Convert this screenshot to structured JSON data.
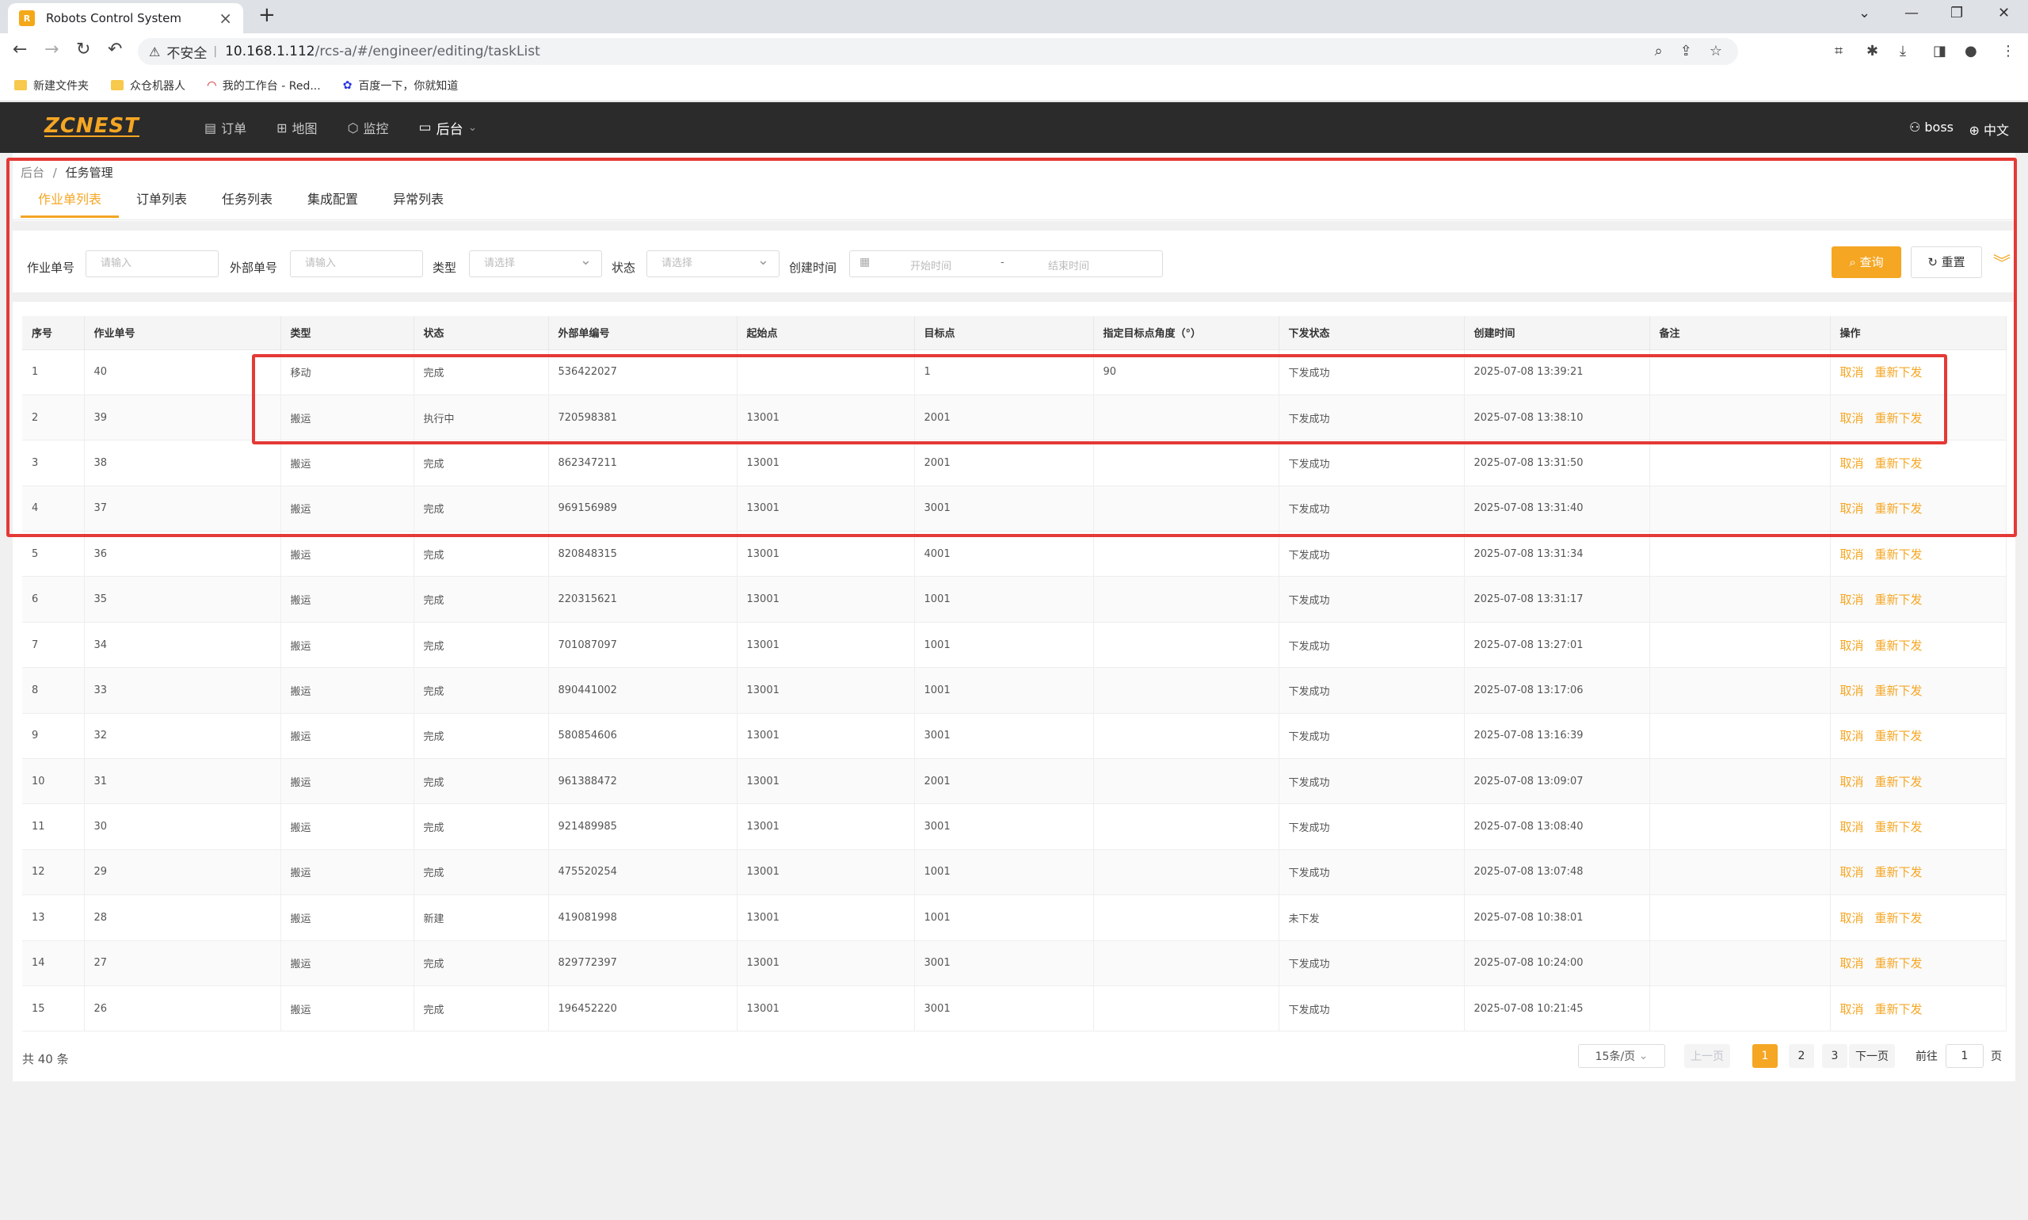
{
  "browser": {
    "tab_title": "Robots Control System",
    "insecure_label": "不安全",
    "url_host": "10.168.1.112",
    "url_path": "/rcs-a/#/engineer/editing/taskList",
    "bookmarks": [
      "新建文件夹",
      "众仓机器人",
      "我的工作台 - Red...",
      "百度一下，你就知道"
    ]
  },
  "app": {
    "logo": "ZCNEST",
    "nav": [
      "订单",
      "地图",
      "监控",
      "后台"
    ],
    "user": "boss",
    "lang": "中文"
  },
  "breadcrumb": {
    "root": "后台",
    "sep": "/",
    "current": "任务管理"
  },
  "tabs": [
    "作业单列表",
    "订单列表",
    "任务列表",
    "集成配置",
    "异常列表"
  ],
  "filter": {
    "labels": [
      "作业单号",
      "外部单号",
      "类型",
      "状态",
      "创建时间"
    ],
    "input_placeholder": "请输入",
    "select_placeholder": "请选择",
    "date_start": "开始时间",
    "date_sep": "-",
    "date_end": "结束时间",
    "query": "查询",
    "reset": "重置"
  },
  "table": {
    "columns": [
      "序号",
      "作业单号",
      "类型",
      "状态",
      "外部单编号",
      "起始点",
      "目标点",
      "指定目标点角度（°）",
      "下发状态",
      "创建时间",
      "备注",
      "操作"
    ],
    "op_cancel": "取消",
    "op_resend": "重新下发",
    "rows": [
      [
        "1",
        "40",
        "移动",
        "完成",
        "536422027",
        "",
        "1",
        "90",
        "下发成功",
        "2025-07-08 13:39:21",
        ""
      ],
      [
        "2",
        "39",
        "搬运",
        "执行中",
        "720598381",
        "13001",
        "2001",
        "",
        "下发成功",
        "2025-07-08 13:38:10",
        ""
      ],
      [
        "3",
        "38",
        "搬运",
        "完成",
        "862347211",
        "13001",
        "2001",
        "",
        "下发成功",
        "2025-07-08 13:31:50",
        ""
      ],
      [
        "4",
        "37",
        "搬运",
        "完成",
        "969156989",
        "13001",
        "3001",
        "",
        "下发成功",
        "2025-07-08 13:31:40",
        ""
      ],
      [
        "5",
        "36",
        "搬运",
        "完成",
        "820848315",
        "13001",
        "4001",
        "",
        "下发成功",
        "2025-07-08 13:31:34",
        ""
      ],
      [
        "6",
        "35",
        "搬运",
        "完成",
        "220315621",
        "13001",
        "1001",
        "",
        "下发成功",
        "2025-07-08 13:31:17",
        ""
      ],
      [
        "7",
        "34",
        "搬运",
        "完成",
        "701087097",
        "13001",
        "1001",
        "",
        "下发成功",
        "2025-07-08 13:27:01",
        ""
      ],
      [
        "8",
        "33",
        "搬运",
        "完成",
        "890441002",
        "13001",
        "1001",
        "",
        "下发成功",
        "2025-07-08 13:17:06",
        ""
      ],
      [
        "9",
        "32",
        "搬运",
        "完成",
        "580854606",
        "13001",
        "3001",
        "",
        "下发成功",
        "2025-07-08 13:16:39",
        ""
      ],
      [
        "10",
        "31",
        "搬运",
        "完成",
        "961388472",
        "13001",
        "2001",
        "",
        "下发成功",
        "2025-07-08 13:09:07",
        ""
      ],
      [
        "11",
        "30",
        "搬运",
        "完成",
        "921489985",
        "13001",
        "3001",
        "",
        "下发成功",
        "2025-07-08 13:08:40",
        ""
      ],
      [
        "12",
        "29",
        "搬运",
        "完成",
        "475520254",
        "13001",
        "1001",
        "",
        "下发成功",
        "2025-07-08 13:07:48",
        ""
      ],
      [
        "13",
        "28",
        "搬运",
        "新建",
        "419081998",
        "13001",
        "1001",
        "",
        "未下发",
        "2025-07-08 10:38:01",
        ""
      ],
      [
        "14",
        "27",
        "搬运",
        "完成",
        "829772397",
        "13001",
        "3001",
        "",
        "下发成功",
        "2025-07-08 10:24:00",
        ""
      ],
      [
        "15",
        "26",
        "搬运",
        "完成",
        "196452220",
        "13001",
        "3001",
        "",
        "下发成功",
        "2025-07-08 10:21:45",
        ""
      ]
    ]
  },
  "pagination": {
    "total": "共 40 条",
    "page_size": "15条/页",
    "prev": "上一页",
    "pages": [
      "1",
      "2",
      "3"
    ],
    "next": "下一页",
    "goto": "前往",
    "current": "1",
    "page_unit": "页"
  },
  "colors": {
    "accent": "#f5a623",
    "header_bg": "#2b2b2b",
    "annotation": "#e53935"
  }
}
